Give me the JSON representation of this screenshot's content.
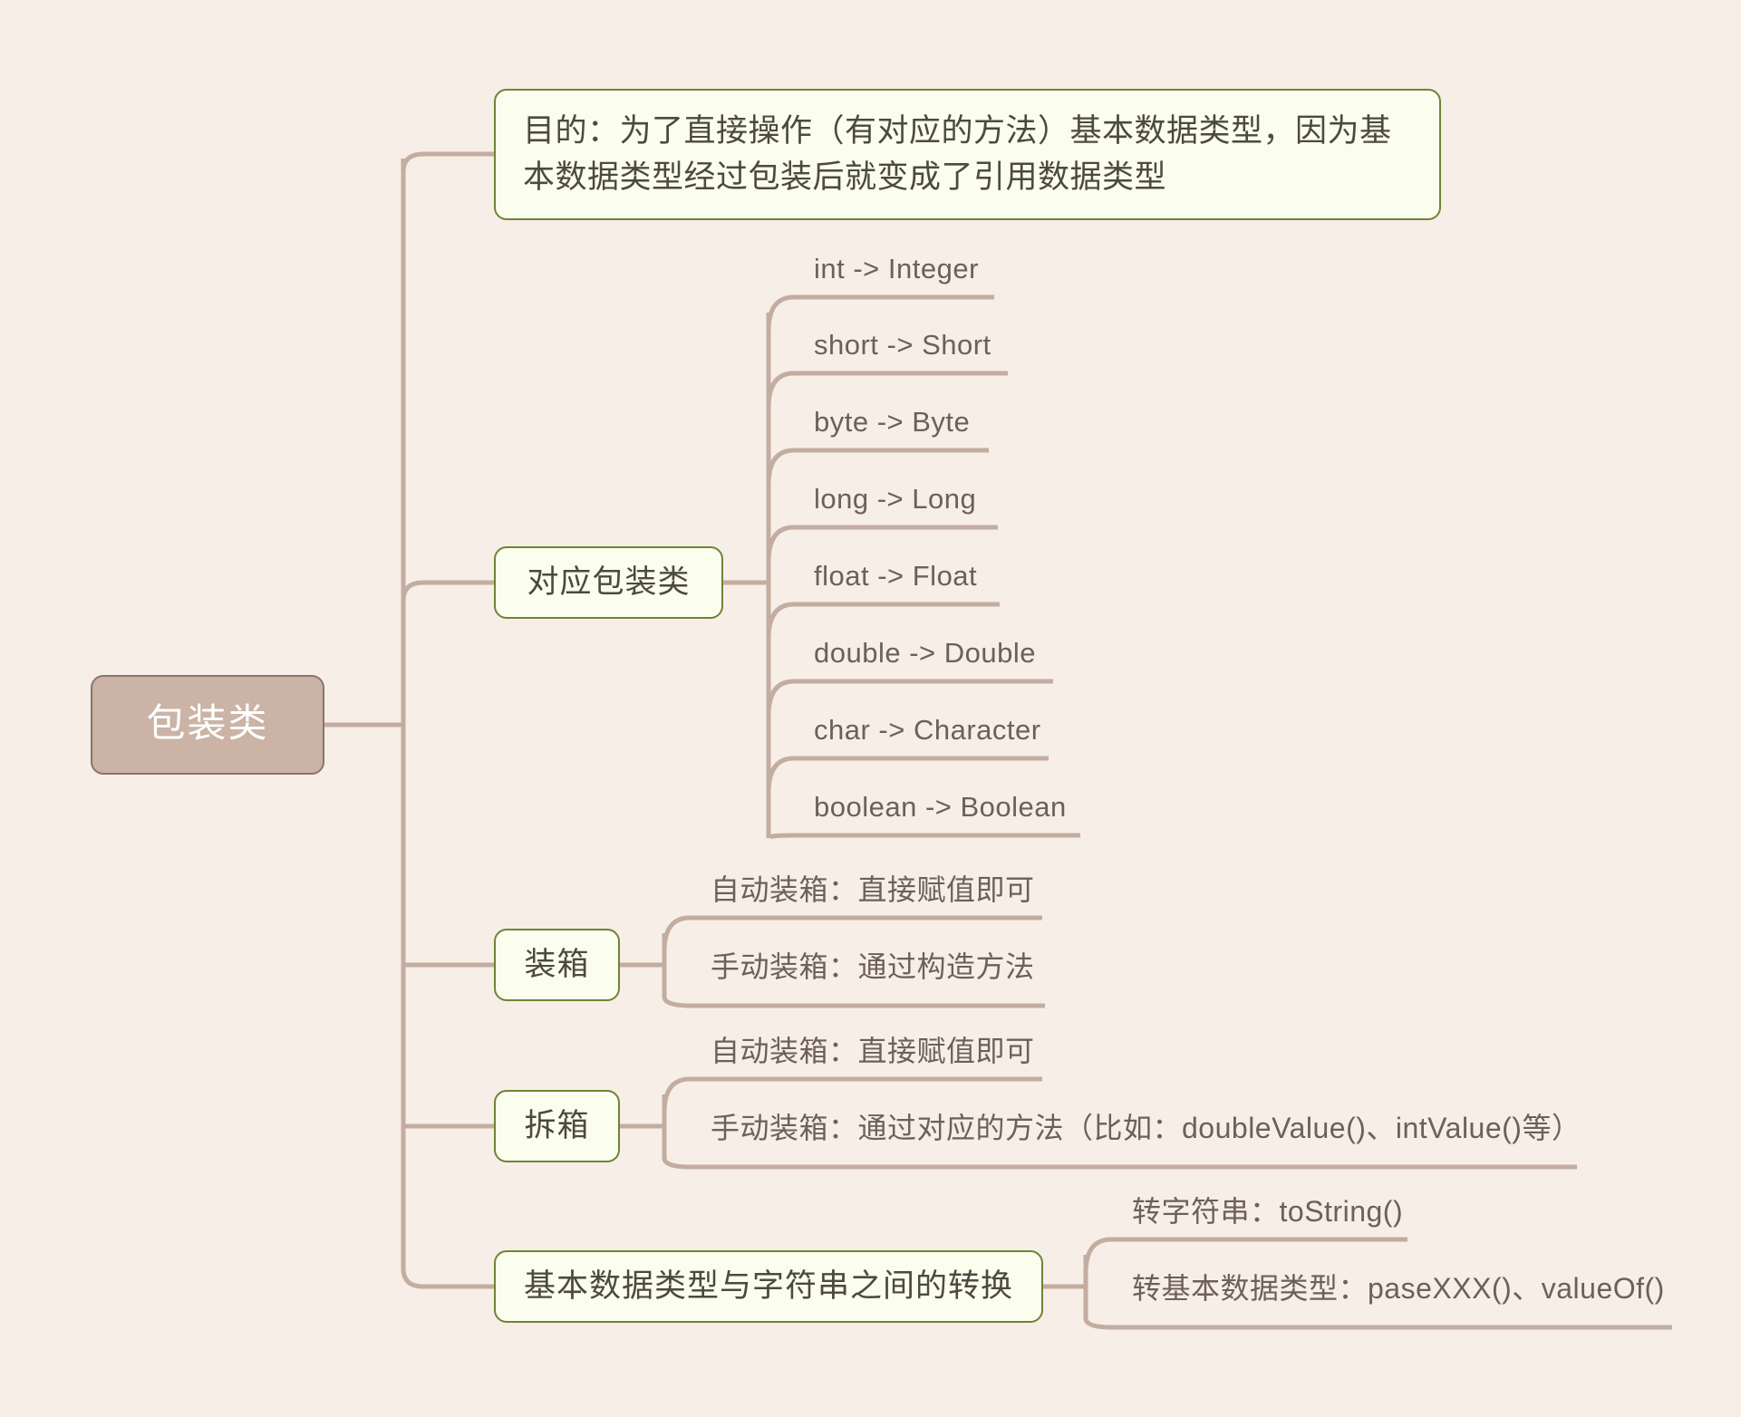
{
  "diagram": {
    "type": "mindmap",
    "title": "包装类",
    "background_color": "#f7eee8",
    "line_color": "#c3ada0",
    "root_fill": "#cbb3a6",
    "root_border": "#8a7569",
    "root_text_color": "#ffffff",
    "branch_fill": "#fbfdef",
    "branch_border": "#6f8434",
    "branch_text_color": "#4c4a3c",
    "leaf_text_color": "#6d6058"
  },
  "root": {
    "label": "包装类"
  },
  "branches": {
    "purpose": {
      "label": "目的：为了直接操作（有对应的方法）基本数据类型，因为基\n本数据类型经过包装后就变成了引用数据类型"
    },
    "wrapper_classes": {
      "label": "对应包装类",
      "items": [
        "int -> Integer",
        "short -> Short",
        "byte -> Byte",
        "long -> Long",
        "float -> Float",
        "double -> Double",
        "char -> Character",
        "boolean -> Boolean"
      ]
    },
    "boxing": {
      "label": "装箱",
      "items": [
        "自动装箱：直接赋值即可",
        "手动装箱：通过构造方法"
      ]
    },
    "unboxing": {
      "label": "拆箱",
      "items": [
        "自动装箱：直接赋值即可",
        "手动装箱：通过对应的方法（比如：doubleValue()、intValue()等）"
      ]
    },
    "string_conversion": {
      "label": "基本数据类型与字符串之间的转换",
      "items": [
        "转字符串：toString()",
        "转基本数据类型：paseXXX()、valueOf()"
      ]
    }
  }
}
